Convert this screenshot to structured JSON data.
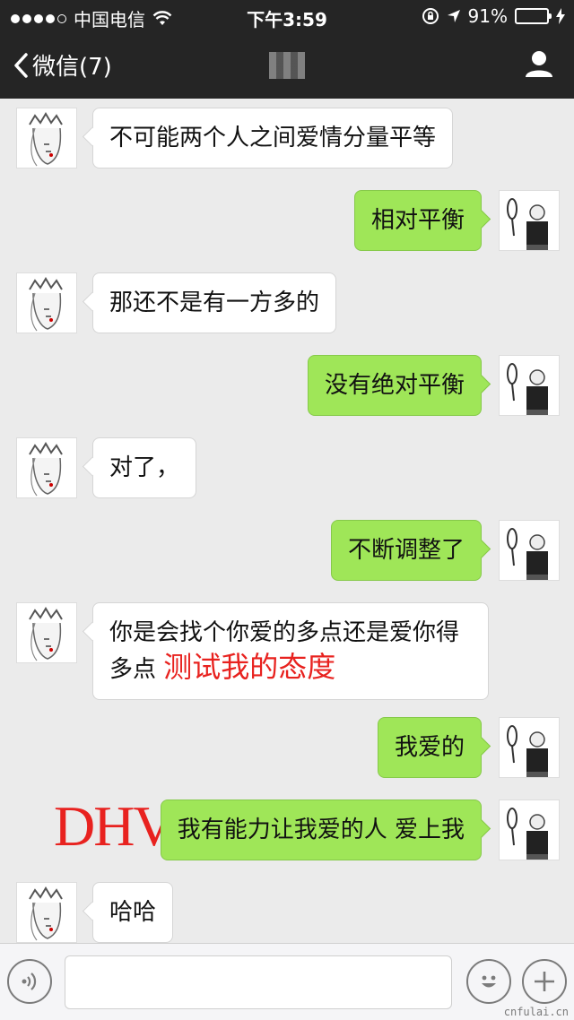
{
  "status_bar": {
    "carrier": "中国电信",
    "time": "下午3:59",
    "battery_text": "91%",
    "battery_level": 0.91
  },
  "nav": {
    "back_label": "微信(7)",
    "title_blurred": ""
  },
  "messages": [
    {
      "side": "in",
      "text": "不可能两个人之间爱情分量平等"
    },
    {
      "side": "out",
      "text": "相对平衡"
    },
    {
      "side": "in",
      "text": "那还不是有一方多的"
    },
    {
      "side": "out",
      "text": "没有绝对平衡"
    },
    {
      "side": "in",
      "text": "对了，"
    },
    {
      "side": "out",
      "text": "不断调整了"
    },
    {
      "side": "in",
      "line1": "你是会找个你爱的多点还是爱你得",
      "line2": "多点",
      "annotation": "测试我的态度"
    },
    {
      "side": "out",
      "text": "我爱的"
    },
    {
      "side": "out",
      "text": "我有能力让我爱的人 爱上我",
      "annotation": "DHV"
    },
    {
      "side": "in",
      "text": "哈哈"
    }
  ],
  "input_bar": {
    "value": "",
    "placeholder": ""
  },
  "watermark": "cnfulai.cn",
  "colors": {
    "header_bg": "#252525",
    "chat_bg": "#ebebeb",
    "outgoing_bubble": "#9fe658",
    "incoming_bubble": "#ffffff",
    "annotation_red": "#e8221f",
    "battery_green": "#4cd964"
  },
  "icons": [
    "signal-dots-icon",
    "wifi-icon",
    "rotation-lock-icon",
    "location-arrow-icon",
    "battery-icon",
    "charging-bolt-icon",
    "back-chevron-icon",
    "user-profile-icon",
    "voice-icon",
    "emoji-icon",
    "plus-icon"
  ]
}
